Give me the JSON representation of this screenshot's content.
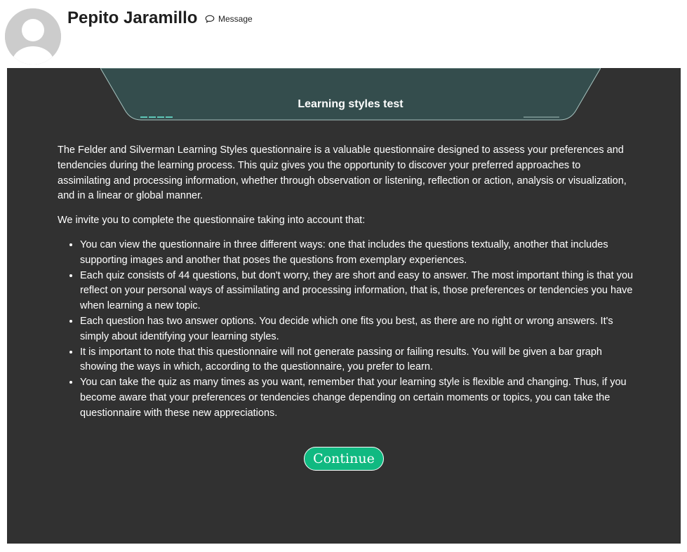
{
  "profile": {
    "name": "Pepito Jaramillo",
    "message_label": "Message"
  },
  "icons": {
    "avatar": "default-user-avatar",
    "message": "speech-bubble-icon"
  },
  "banner": {
    "title": "Learning styles test"
  },
  "intro": {
    "paragraph1": "The Felder and Silverman Learning Styles questionnaire is a valuable questionnaire designed to assess your preferences and tendencies during the learning process. This quiz gives you the opportunity to discover your preferred approaches to assimilating and processing information, whether through observation or listening, reflection or action, analysis or visualization, and in a linear or global manner.",
    "paragraph2": "We invite you to complete the questionnaire taking into account that:",
    "bullets": [
      "You can view the questionnaire in three different ways: one that includes the questions textually, another that includes supporting images and another that poses the questions from exemplary experiences.",
      "Each quiz consists of 44 questions, but don't worry, they are short and easy to answer. The most important thing is that you reflect on your personal ways of assimilating and processing information, that is, those preferences or tendencies you have when learning a new topic.",
      "Each question has two answer options. You decide which one fits you best, as there are no right or wrong answers. It's simply about identifying your learning styles.",
      "It is important to note that this questionnaire will not generate passing or failing results. You will be given a bar graph showing the ways in which, according to the questionnaire, you prefer to learn.",
      "You can take the quiz as many times as you want, remember that your learning style is flexible and changing. Thus, if you become aware that your preferences or tendencies change depending on certain moments or topics, you can take the questionnaire with these new appreciations."
    ]
  },
  "actions": {
    "continue_label": "Continue"
  },
  "colors": {
    "panel_bg": "#313131",
    "banner_bg": "#344d4d",
    "button_bg": "#10b981",
    "accent_line": "#5fc7b8"
  }
}
